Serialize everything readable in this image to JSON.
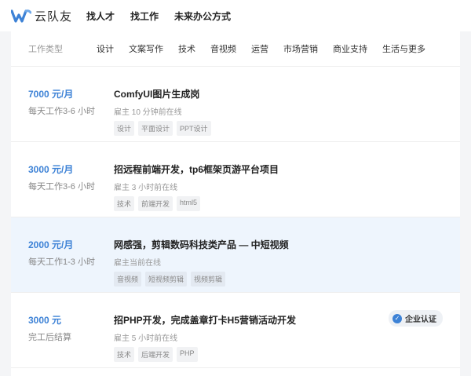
{
  "brand": {
    "name": "云队友",
    "accent": "#3d82d6"
  },
  "nav": [
    {
      "label": "找人才"
    },
    {
      "label": "找工作"
    },
    {
      "label": "未来办公方式"
    }
  ],
  "filter": {
    "label": "工作类型",
    "categories": [
      "设计",
      "文案写作",
      "技术",
      "音视频",
      "运营",
      "市场营销",
      "商业支持",
      "生活与更多"
    ]
  },
  "jobs": [
    {
      "salary": "7000 元/月",
      "worktime": "每天工作3-6 小时",
      "title": "ComfyUI图片生成岗",
      "employer": "雇主 10 分钟前在线",
      "tags": [
        "设计",
        "平面设计",
        "PPT设计"
      ]
    },
    {
      "salary": "3000 元/月",
      "worktime": "每天工作3-6 小时",
      "title": "招远程前端开发，tp6框架页游平台项目",
      "employer": "雇主 3 小时前在线",
      "tags": [
        "技术",
        "前端开发",
        "html5"
      ]
    },
    {
      "salary": "2000 元/月",
      "worktime": "每天工作1-3 小时",
      "title": "网感强，剪辑数码科技类产品 — 中短视频",
      "employer": "雇主当前在线",
      "tags": [
        "音视频",
        "短视频剪辑",
        "视频剪辑"
      ]
    },
    {
      "salary": "3000 元",
      "worktime": "完工后结算",
      "title": "招PHP开发，完成盖章打卡H5营销活动开发",
      "employer": "雇主 5 小时前在线",
      "tags": [
        "技术",
        "后端开发",
        "PHP"
      ],
      "badge": "企业认证"
    }
  ]
}
